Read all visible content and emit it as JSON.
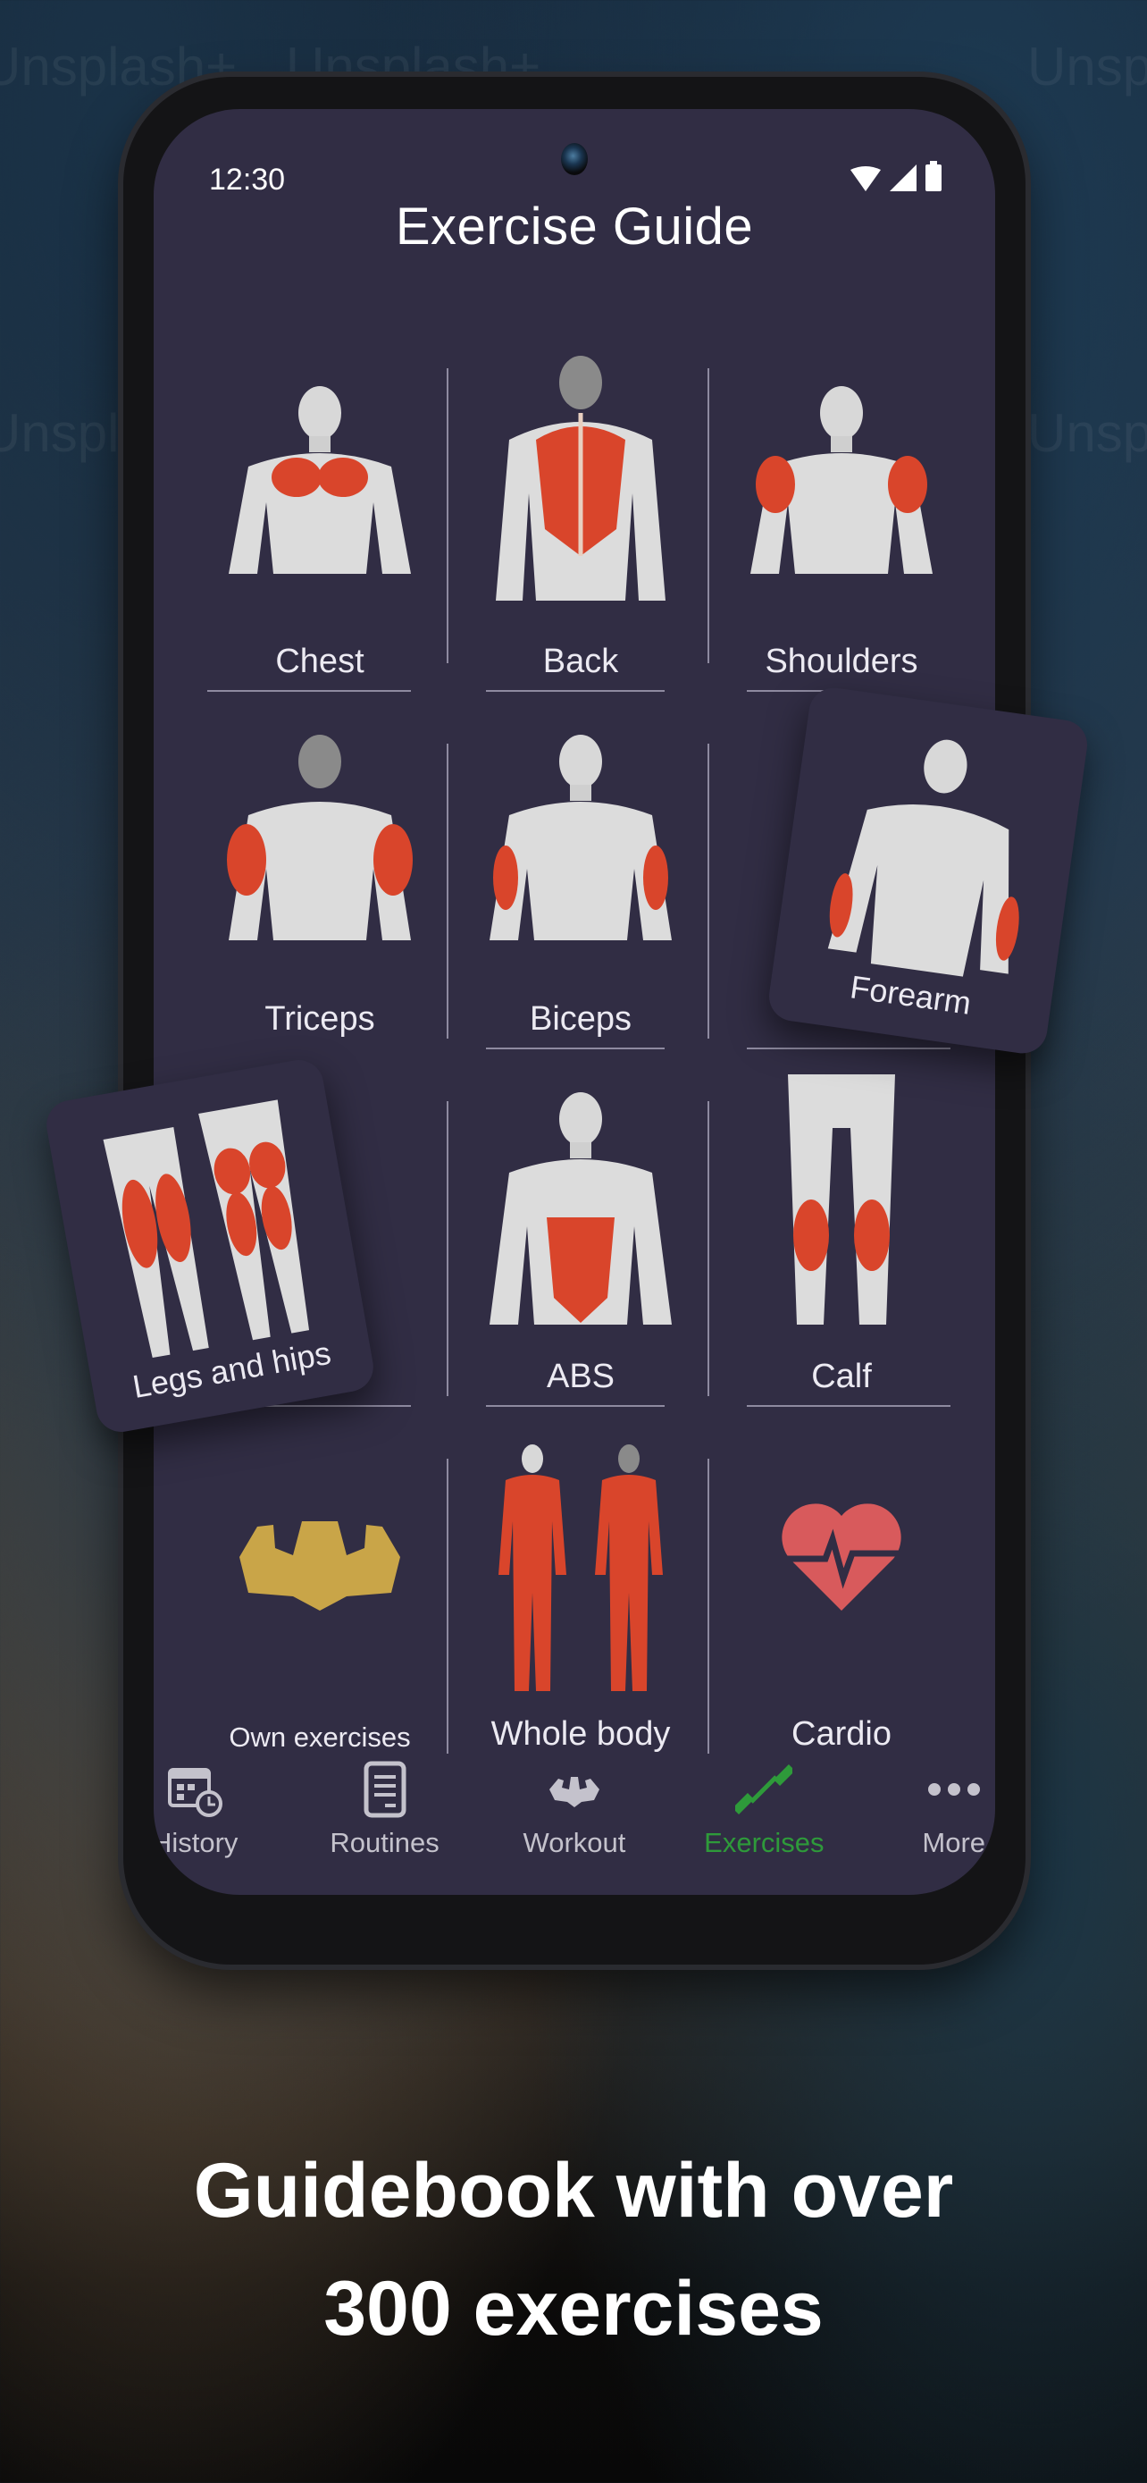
{
  "background": {
    "watermarks": [
      "Unsplash+",
      "Unsplash+",
      "Unsplash+",
      "Unsplash+",
      "Unsplash+"
    ]
  },
  "status_bar": {
    "time": "12:30",
    "icons": [
      "wifi-icon",
      "signal-icon",
      "battery-icon"
    ]
  },
  "app": {
    "title": "Exercise Guide"
  },
  "categories": [
    {
      "label": "Chest",
      "highlight": "chest"
    },
    {
      "label": "Back",
      "highlight": "back"
    },
    {
      "label": "Shoulders",
      "highlight": "shoulders"
    },
    {
      "label": "Triceps",
      "highlight": "triceps"
    },
    {
      "label": "Biceps",
      "highlight": "biceps"
    },
    {
      "label": "Forearm",
      "highlight": "forearm"
    },
    {
      "label": "Legs and hips",
      "highlight": "legs"
    },
    {
      "label": "ABS",
      "highlight": "abs"
    },
    {
      "label": "Calf",
      "highlight": "calf"
    },
    {
      "label": "Own exercises",
      "icon": "flexing-arms-icon"
    },
    {
      "label": "Whole body",
      "highlight": "whole"
    },
    {
      "label": "Cardio",
      "icon": "heart-pulse-icon"
    }
  ],
  "bottom_nav": {
    "items": [
      {
        "label": "History",
        "visible_label": "History",
        "icon": "calendar-clock-icon",
        "active": false
      },
      {
        "label": "Routines",
        "visible_label": "Routines",
        "icon": "clipboard-list-icon",
        "active": false
      },
      {
        "label": "Workout",
        "visible_label": "Workout",
        "icon": "flexing-arms-icon",
        "active": false
      },
      {
        "label": "Exercises",
        "visible_label": "Exercises",
        "icon": "dumbbell-icon",
        "active": true
      },
      {
        "label": "More",
        "visible_label": "More",
        "icon": "more-dots-icon",
        "active": false
      }
    ]
  },
  "colors": {
    "screen_bg": "#312d44",
    "muscle_highlight": "#d9452b",
    "active_nav": "#2e9a3a",
    "own_exercises_icon": "#c9a548",
    "cardio_icon": "#d85a5c"
  },
  "headline": {
    "line1": "Guidebook with over",
    "line2": "300 exercises"
  }
}
